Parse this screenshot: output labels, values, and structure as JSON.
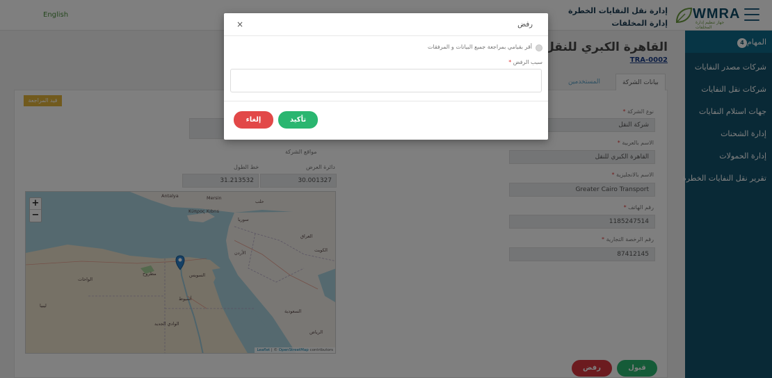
{
  "header": {
    "language": "English",
    "org_name_line1": "إدارة نقل النفايات الخطرة",
    "org_name_line2": "إدارة المخلفات",
    "logo_text": "WMRA",
    "logo_subtitle": "جهاز تنظيم إدارة المخلفات",
    "menu_icon": "hamburger-icon"
  },
  "sidebar": {
    "tasks_label": "المهام",
    "tasks_count": "4",
    "items": [
      "شركات مصدر النفايات",
      "شركات نقل النفايات",
      "جهات استلام النفايات",
      "إدارة الشحنات",
      "إدارة الحمولات",
      "تقرير نقل النفايات الخطرة"
    ]
  },
  "page": {
    "title": "القاهرة الكبري للنقل",
    "code": "TRA-0002",
    "tabs": {
      "company_data": "بيانات الشركة",
      "users": "المستخدمين"
    },
    "status_badge": "قيد المراجعة"
  },
  "form": {
    "company_type": {
      "label": "نوع الشركة",
      "value": "شركة النقل"
    },
    "name_ar": {
      "label": "الاسم بالعربية",
      "value": "القاهرة الكبري للنقل"
    },
    "name_en": {
      "label": "الاسم بالانجليزية",
      "value": "Greater Cairo Transport"
    },
    "phone": {
      "label": "رقم الهاتف",
      "value": "1185247514"
    },
    "license": {
      "label": "رقم الرخصة التجارية",
      "value": "87412145"
    },
    "required_mark": "*"
  },
  "location": {
    "title": "مواقع الشركة",
    "lat_label": "دائرة العرض",
    "lng_label": "خط الطول",
    "lat_value": "30.001327",
    "lng_value": "31.213532"
  },
  "map": {
    "zoom_in": "+",
    "zoom_out": "−",
    "attribution_leaflet": "Leaflet",
    "attribution_sep": " | © ",
    "attribution_osm": "OpenStreetMap",
    "attribution_rest": " contributors",
    "labels": [
      "Antalya",
      "Mersin",
      "Κύπρος Kıbrıs",
      "حلب",
      "سوريا",
      "العراق",
      "الأردن",
      "الكويت",
      "السويس",
      "أسيوط",
      "السعودية",
      "الرياض",
      "ليبيا",
      "مطروح",
      "الواحات",
      "الوادي الجديد"
    ],
    "marker_icon": "map-pin-icon",
    "colors": {
      "sea": "#aad3df",
      "land": "#f2efe9",
      "desert": "#ece3cc"
    }
  },
  "actions": {
    "accept": "قبول",
    "reject": "رفض"
  },
  "modal": {
    "title": "رفض",
    "close": "×",
    "checkbox_label": "أقر بقيامي بمراجعة جميع البيانات و المرفقات",
    "reason_label": "سبب الرفض",
    "reason_value": "",
    "confirm": "تأكيد",
    "cancel": "إلغاء"
  },
  "colors": {
    "sidebar": "#13526c",
    "accept": "#2ab670",
    "reject": "#d9363e",
    "badge": "#e2b53a"
  }
}
